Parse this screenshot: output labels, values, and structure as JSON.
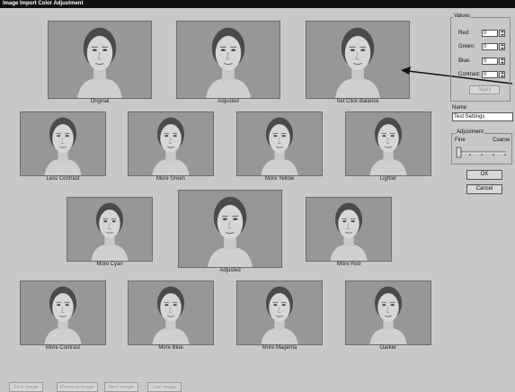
{
  "window": {
    "title": "Image Import Color Adjustment"
  },
  "thumbnails": [
    {
      "label": "Original"
    },
    {
      "label": "Adjusted"
    },
    {
      "label": "Set Click Balance"
    },
    {
      "label": "Less Contrast"
    },
    {
      "label": "More Green"
    },
    {
      "label": "More Yellow"
    },
    {
      "label": "Lighter"
    },
    {
      "label": "More Cyan"
    },
    {
      "label": "Adjusted"
    },
    {
      "label": "More Red"
    },
    {
      "label": "More Contrast"
    },
    {
      "label": "More Blue"
    },
    {
      "label": "More Magenta"
    },
    {
      "label": "Darker"
    }
  ],
  "values_group": {
    "legend": "Values",
    "red_label": "Red:",
    "red_value": "0",
    "green_label": "Green:",
    "green_value": "0",
    "blue_label": "Blue:",
    "blue_value": "0",
    "contrast_label": "Contrast:",
    "contrast_value": "0",
    "apply_label": "Apply"
  },
  "name_field": {
    "label": "Name",
    "value": "Test Settings"
  },
  "adjustment_group": {
    "legend": "Adjustment",
    "fine_label": "Fine",
    "coarse_label": "Coarse",
    "level": 0
  },
  "buttons": {
    "ok_label": "OK",
    "cancel_label": "Cancel"
  },
  "nav_buttons": [
    {
      "label": "First image"
    },
    {
      "label": "Previous image"
    },
    {
      "label": "Next image"
    },
    {
      "label": "Last image"
    }
  ]
}
